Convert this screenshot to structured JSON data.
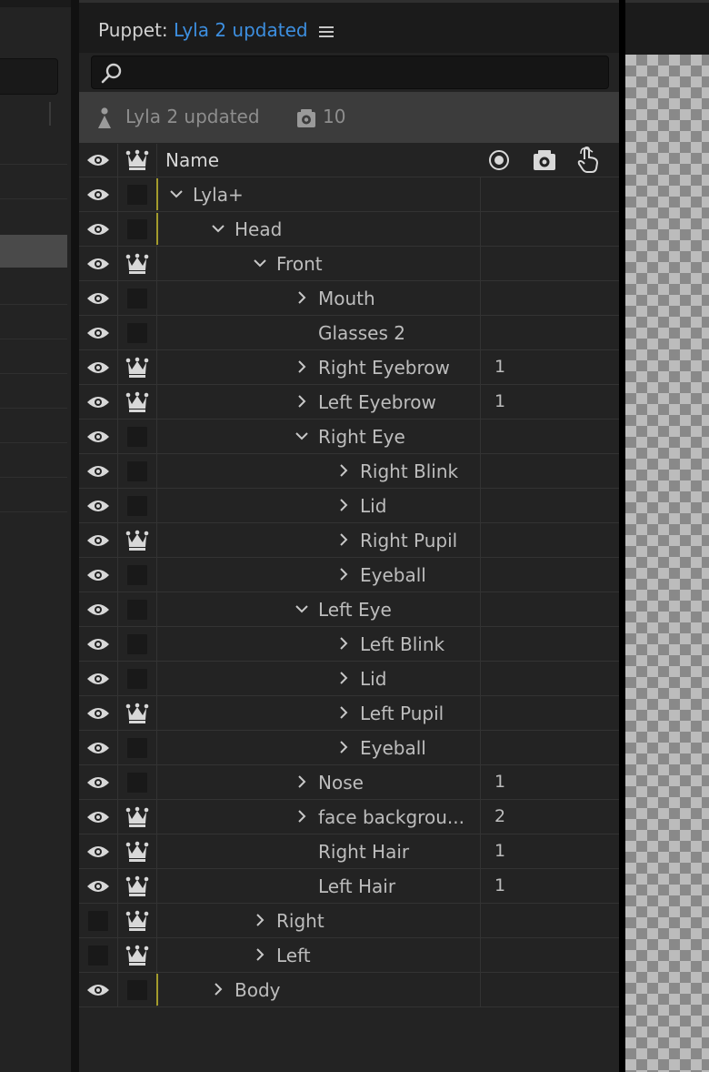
{
  "panel": {
    "title_prefix": "Puppet:",
    "title_name": "Lyla 2 updated",
    "menu_icon": "hamburger-menu-icon"
  },
  "search": {
    "placeholder": "",
    "value": ""
  },
  "puppet_bar": {
    "name": "Lyla 2 updated",
    "count": "10"
  },
  "columns": {
    "name": "Name",
    "visibility_icon": "eye-icon",
    "leader_icon": "crown-icon",
    "col3_icon": "record-target-icon",
    "col4_icon": "behavior-gear-icon",
    "col5_icon": "touch-hand-icon"
  },
  "colors": {
    "accent": "#3d8fe0",
    "mark": "#a39b2c"
  },
  "layers": [
    {
      "name": "Lyla+",
      "depth": 0,
      "expander": "down",
      "visible": true,
      "crown": false,
      "count": "",
      "mark": true
    },
    {
      "name": "Head",
      "depth": 1,
      "expander": "down",
      "visible": true,
      "crown": false,
      "count": "",
      "mark": true
    },
    {
      "name": "Front",
      "depth": 2,
      "expander": "down",
      "visible": true,
      "crown": true,
      "count": "",
      "mark": false
    },
    {
      "name": "Mouth",
      "depth": 3,
      "expander": "right",
      "visible": true,
      "crown": false,
      "count": "",
      "mark": false
    },
    {
      "name": "Glasses 2",
      "depth": 3,
      "expander": "none",
      "visible": true,
      "crown": false,
      "count": "",
      "mark": false
    },
    {
      "name": "Right Eyebrow",
      "depth": 3,
      "expander": "right",
      "visible": true,
      "crown": true,
      "count": "1",
      "mark": false
    },
    {
      "name": "Left Eyebrow",
      "depth": 3,
      "expander": "right",
      "visible": true,
      "crown": true,
      "count": "1",
      "mark": false
    },
    {
      "name": "Right Eye",
      "depth": 3,
      "expander": "down",
      "visible": true,
      "crown": false,
      "count": "",
      "mark": false
    },
    {
      "name": "Right Blink",
      "depth": 4,
      "expander": "right",
      "visible": true,
      "crown": false,
      "count": "",
      "mark": false
    },
    {
      "name": "Lid",
      "depth": 4,
      "expander": "right",
      "visible": true,
      "crown": false,
      "count": "",
      "mark": false
    },
    {
      "name": "Right Pupil",
      "depth": 4,
      "expander": "right",
      "visible": true,
      "crown": true,
      "count": "",
      "mark": false
    },
    {
      "name": "Eyeball",
      "depth": 4,
      "expander": "right",
      "visible": true,
      "crown": false,
      "count": "",
      "mark": false
    },
    {
      "name": "Left Eye",
      "depth": 3,
      "expander": "down",
      "visible": true,
      "crown": false,
      "count": "",
      "mark": false
    },
    {
      "name": "Left Blink",
      "depth": 4,
      "expander": "right",
      "visible": true,
      "crown": false,
      "count": "",
      "mark": false
    },
    {
      "name": "Lid",
      "depth": 4,
      "expander": "right",
      "visible": true,
      "crown": false,
      "count": "",
      "mark": false
    },
    {
      "name": "Left Pupil",
      "depth": 4,
      "expander": "right",
      "visible": true,
      "crown": true,
      "count": "",
      "mark": false
    },
    {
      "name": "Eyeball",
      "depth": 4,
      "expander": "right",
      "visible": true,
      "crown": false,
      "count": "",
      "mark": false
    },
    {
      "name": "Nose",
      "depth": 3,
      "expander": "right",
      "visible": true,
      "crown": false,
      "count": "1",
      "mark": false
    },
    {
      "name": "face backgrou...",
      "depth": 3,
      "expander": "right",
      "visible": true,
      "crown": true,
      "count": "2",
      "mark": false
    },
    {
      "name": "Right Hair",
      "depth": 3,
      "expander": "none",
      "visible": true,
      "crown": true,
      "count": "1",
      "mark": false
    },
    {
      "name": "Left Hair",
      "depth": 3,
      "expander": "none",
      "visible": true,
      "crown": true,
      "count": "1",
      "mark": false
    },
    {
      "name": "Right",
      "depth": 2,
      "expander": "right",
      "visible": false,
      "crown": true,
      "count": "",
      "mark": false
    },
    {
      "name": "Left",
      "depth": 2,
      "expander": "right",
      "visible": false,
      "crown": true,
      "count": "",
      "mark": false
    },
    {
      "name": "Body",
      "depth": 1,
      "expander": "right",
      "visible": true,
      "crown": false,
      "count": "",
      "mark": true
    }
  ]
}
